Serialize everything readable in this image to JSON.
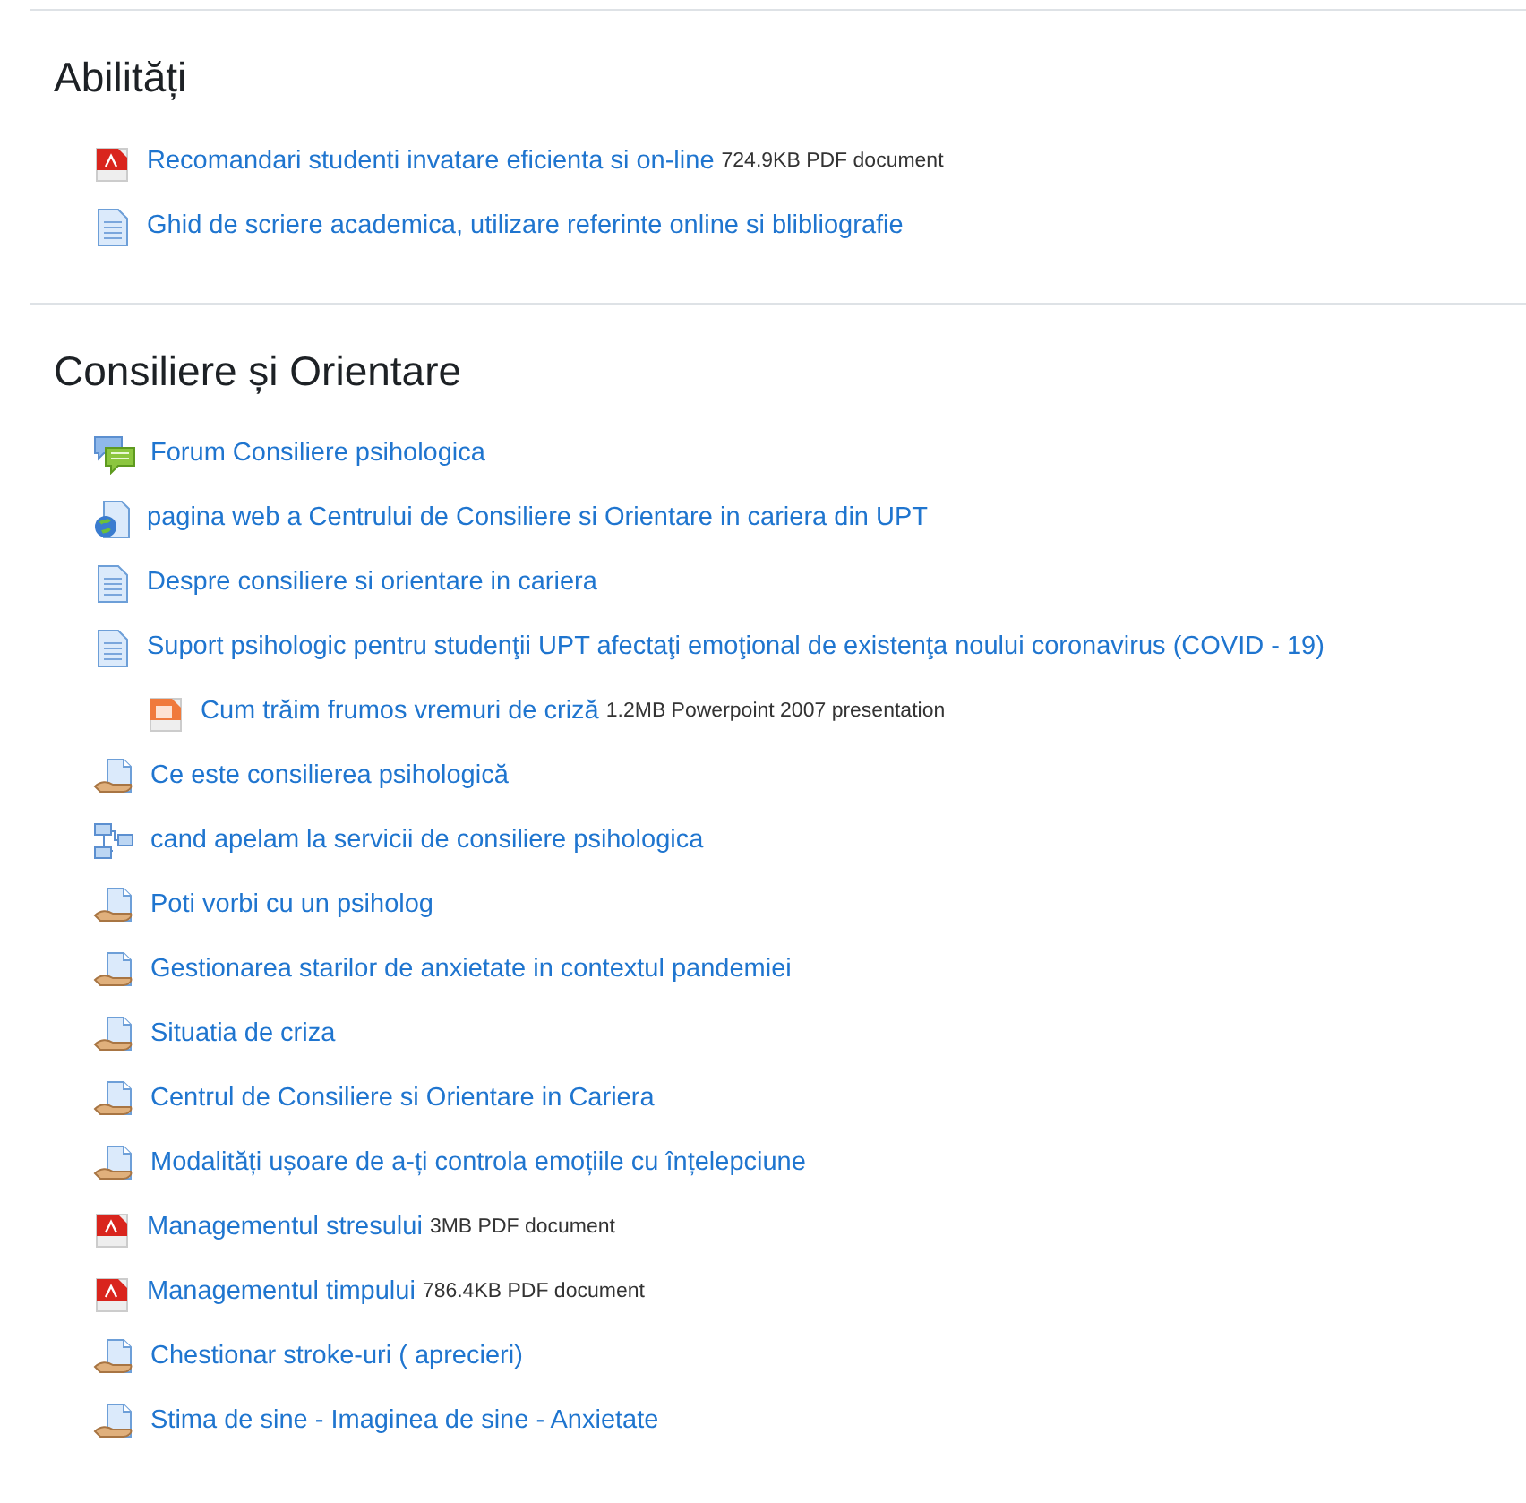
{
  "sections": [
    {
      "title": "Abilități",
      "items": [
        {
          "kind": "pdf",
          "label": "Recomandari studenti invatare eficienta si on-line",
          "details": "724.9KB PDF document"
        },
        {
          "kind": "page",
          "label": "Ghid de scriere academica, utilizare referinte online si blibliografie"
        }
      ]
    },
    {
      "title": "Consiliere și Orientare",
      "items": [
        {
          "kind": "forum",
          "label": "Forum Consiliere psihologica"
        },
        {
          "kind": "url",
          "label": "pagina web a Centrului de Consiliere si Orientare in cariera din UPT"
        },
        {
          "kind": "page",
          "label": "Despre consiliere si orientare in cariera"
        },
        {
          "kind": "page",
          "label": "Suport psihologic pentru studenţii UPT afectaţi emoţional de existenţa noului coronavirus (COVID - 19)",
          "children": [
            {
              "kind": "ppt",
              "label": "Cum trăim frumos vremuri de criză",
              "details": "1.2MB Powerpoint 2007 presentation"
            }
          ]
        },
        {
          "kind": "shared",
          "label": "Ce este consilierea psihologică"
        },
        {
          "kind": "tree",
          "label": "cand apelam la servicii de consiliere psihologica"
        },
        {
          "kind": "shared",
          "label": "Poti vorbi cu un psiholog"
        },
        {
          "kind": "shared",
          "label": "Gestionarea starilor de anxietate in contextul pandemiei"
        },
        {
          "kind": "shared",
          "label": "Situatia de criza"
        },
        {
          "kind": "shared",
          "label": "Centrul de Consiliere si Orientare in Cariera"
        },
        {
          "kind": "shared",
          "label": "Modalități ușoare de a-ți controla emoțiile cu înțelepciune"
        },
        {
          "kind": "pdf",
          "label": "Managementul stresului",
          "details": "3MB PDF document"
        },
        {
          "kind": "pdf",
          "label": "Managementul timpului",
          "details": "786.4KB PDF document"
        },
        {
          "kind": "shared",
          "label": "Chestionar stroke-uri ( aprecieri)"
        },
        {
          "kind": "shared",
          "label": "Stima de sine - Imaginea de sine - Anxietate"
        }
      ]
    }
  ]
}
